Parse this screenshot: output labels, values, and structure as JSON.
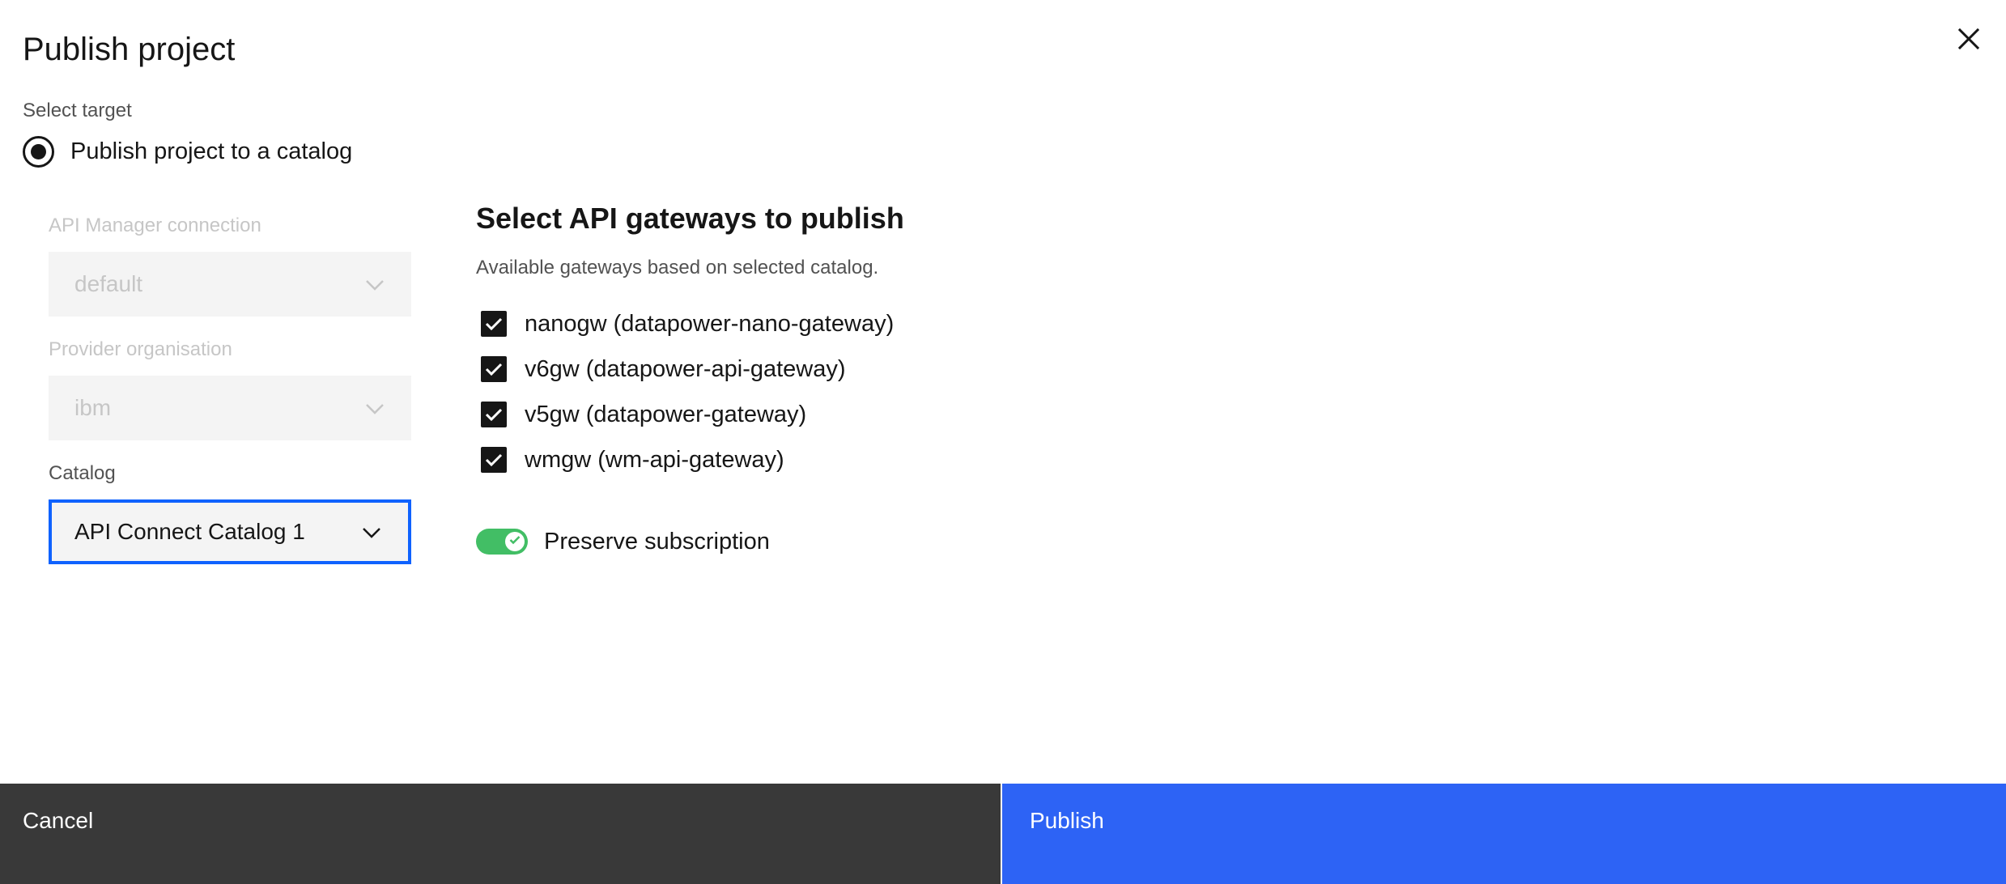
{
  "modal": {
    "title": "Publish project",
    "close_icon": "close-icon"
  },
  "target": {
    "section_label": "Select target",
    "option_label": "Publish project to a catalog",
    "selected": true
  },
  "form": {
    "api_manager": {
      "label": "API Manager connection",
      "value": "default",
      "disabled": true
    },
    "provider_org": {
      "label": "Provider organisation",
      "value": "ibm",
      "disabled": true
    },
    "catalog": {
      "label": "Catalog",
      "value": "API Connect Catalog 1",
      "disabled": false
    }
  },
  "gateways": {
    "heading": "Select API gateways to publish",
    "subtitle": "Available gateways based on selected catalog.",
    "items": [
      {
        "label": "nanogw (datapower-nano-gateway)",
        "checked": true
      },
      {
        "label": "v6gw (datapower-api-gateway)",
        "checked": true
      },
      {
        "label": "v5gw (datapower-gateway)",
        "checked": true
      },
      {
        "label": "wmgw (wm-api-gateway)",
        "checked": true
      }
    ]
  },
  "preserve_subscription": {
    "label": "Preserve subscription",
    "on": true
  },
  "footer": {
    "cancel_label": "Cancel",
    "publish_label": "Publish"
  },
  "colors": {
    "primary": "#2d63f5",
    "secondary": "#393939",
    "toggle_on": "#42be65",
    "focus": "#0f62fe"
  }
}
